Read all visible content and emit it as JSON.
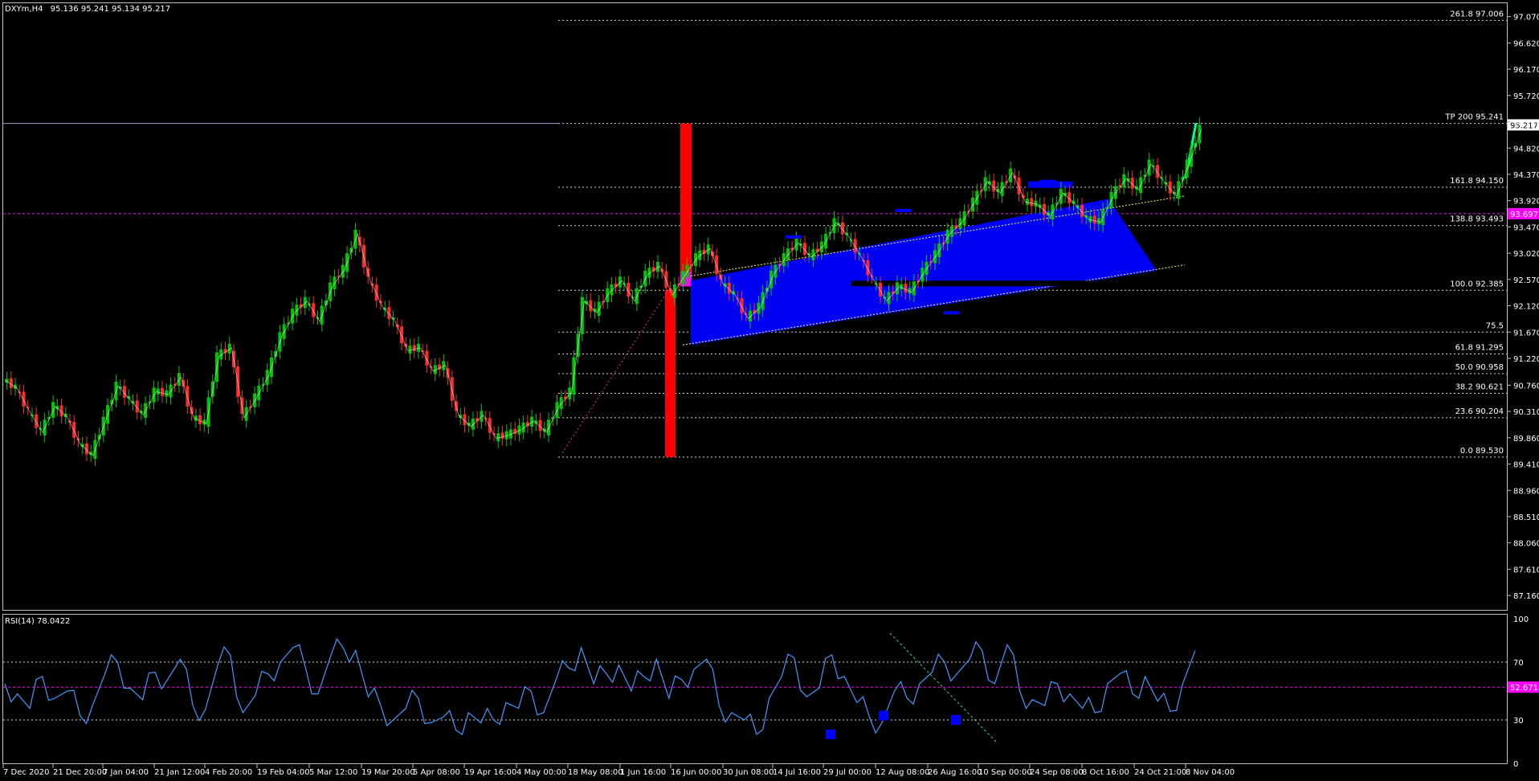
{
  "header": {
    "symbol": "DXYm,H4",
    "ohlc": "95.136 95.241 95.134 95.217"
  },
  "rsi_header": "RSI(14) 78.0422",
  "colors": {
    "background": "#000000",
    "bull_candle": "#00c800",
    "bear_candle": "#ff2a2a",
    "channel_fill": "#0000ff",
    "red_bar": "#ff0000",
    "magenta_level": "#ff00ff",
    "rsi_line": "#3d9bff",
    "tp_arrow": "#00ff99",
    "grid_text": "#ffffff"
  },
  "chart_data": [
    {
      "type": "line",
      "title": "DXYm,H4",
      "subtitle": "95.136 95.241 95.134 95.217",
      "ylim": [
        86.9,
        97.3
      ],
      "y_ticks": [
        "97.070",
        "96.620",
        "96.170",
        "95.720",
        "95.270",
        "94.820",
        "94.370",
        "93.920",
        "93.470",
        "93.020",
        "92.570",
        "92.120",
        "91.670",
        "91.220",
        "90.760",
        "90.310",
        "89.860",
        "89.410",
        "88.960",
        "88.510",
        "88.060",
        "87.610",
        "87.160"
      ],
      "x_ticks": [
        "7 Dec 2020",
        "21 Dec 20:00",
        "7 Jan 04:00",
        "21 Jan 12:00",
        "4 Feb 20:00",
        "19 Feb 04:00",
        "5 Mar 12:00",
        "19 Mar 20:00",
        "5 Apr 08:00",
        "19 Apr 16:00",
        "4 May 00:00",
        "18 May 08:00",
        "1 Jun 16:00",
        "16 Jun 00:00",
        "30 Jun 08:00",
        "14 Jul 16:00",
        "29 Jul 00:00",
        "12 Aug 08:00",
        "26 Aug 16:00",
        "10 Sep 00:00",
        "24 Sep 08:00",
        "8 Oct 16:00",
        "24 Oct 21:00",
        "8 Nov 04:00"
      ],
      "series": [
        {
          "values": [
            90.85,
            90.7,
            90.3,
            89.95,
            90.4,
            90.2,
            89.75,
            89.55,
            90.15,
            90.75,
            90.5,
            90.25,
            90.65,
            90.6,
            90.9,
            90.2,
            90.1,
            91.25,
            91.4,
            90.2,
            90.55,
            90.95,
            91.6,
            92.0,
            92.2,
            91.85,
            92.45,
            92.75,
            93.35,
            92.55,
            92.1,
            91.85,
            91.35,
            91.4,
            91.0,
            91.1,
            90.25,
            90.05,
            90.25,
            89.85,
            89.9,
            90.0,
            90.15,
            89.95,
            90.4,
            90.65,
            92.2,
            92.0,
            92.35,
            92.55,
            92.2,
            92.65,
            92.8,
            92.3,
            92.65,
            92.95,
            93.1,
            92.5,
            92.3,
            91.9,
            92.1,
            92.65,
            92.95,
            93.2,
            92.95,
            93.15,
            93.55,
            93.3,
            92.95,
            92.55,
            92.2,
            92.45,
            92.35,
            92.7,
            93.0,
            93.35,
            93.55,
            93.9,
            94.25,
            94.05,
            94.4,
            93.9,
            93.85,
            93.65,
            94.05,
            93.85,
            93.6,
            93.55,
            94.0,
            94.3,
            94.1,
            94.55,
            94.25,
            94.0,
            94.55,
            95.15
          ]
        }
      ],
      "fibonacci_levels": [
        {
          "label": "261.8 97.006",
          "value": 97.006
        },
        {
          "label": "TP 200 95.241",
          "value": 95.241
        },
        {
          "label": "161.8 94.150",
          "value": 94.15
        },
        {
          "label": "138.8 93.493",
          "value": 93.493
        },
        {
          "label": "100.0 92.385",
          "value": 92.385
        },
        {
          "label": "75.5",
          "value": 91.67
        },
        {
          "label": "61.8 91.295",
          "value": 91.295
        },
        {
          "label": "50.0 90.958",
          "value": 90.958
        },
        {
          "label": "38.2 90.621",
          "value": 90.621
        },
        {
          "label": "23.6 90.204",
          "value": 90.204
        },
        {
          "label": "0.0 89.530",
          "value": 89.53
        }
      ],
      "current_price_tag": "95.217",
      "magenta_level_tag": "93.697",
      "magenta_level_value": 93.697,
      "channel": {
        "lower_start": 91.45,
        "lower_end": 92.72,
        "upper_start": 92.55,
        "upper_end": 93.95
      },
      "pivots": [
        93.3,
        93.75,
        92.0,
        94.25
      ],
      "grid": false
    },
    {
      "type": "line",
      "title": "RSI(14) 78.0422",
      "ylim": [
        0,
        100
      ],
      "y_ticks": [
        "100",
        "70",
        "30",
        "0"
      ],
      "levels": [
        70,
        30
      ],
      "magenta_level_tag": "52.6718",
      "magenta_level_value": 52.6718,
      "series": [
        {
          "values": [
            55,
            48,
            38,
            60,
            45,
            50,
            33,
            40,
            62,
            70,
            52,
            44,
            63,
            58,
            72,
            40,
            37,
            68,
            75,
            35,
            47,
            62,
            70,
            80,
            66,
            48,
            74,
            80,
            78,
            46,
            40,
            30,
            38,
            45,
            28,
            32,
            23,
            35,
            28,
            30,
            42,
            38,
            50,
            35,
            58,
            66,
            80,
            55,
            62,
            68,
            50,
            60,
            72,
            45,
            58,
            65,
            72,
            40,
            35,
            30,
            20,
            45,
            60,
            73,
            46,
            52,
            75,
            60,
            42,
            32,
            28,
            50,
            45,
            55,
            63,
            70,
            62,
            72,
            78,
            55,
            82,
            50,
            44,
            40,
            55,
            48,
            38,
            35,
            55,
            62,
            48,
            60,
            43,
            36,
            55,
            78
          ]
        }
      ],
      "grid": false
    }
  ]
}
